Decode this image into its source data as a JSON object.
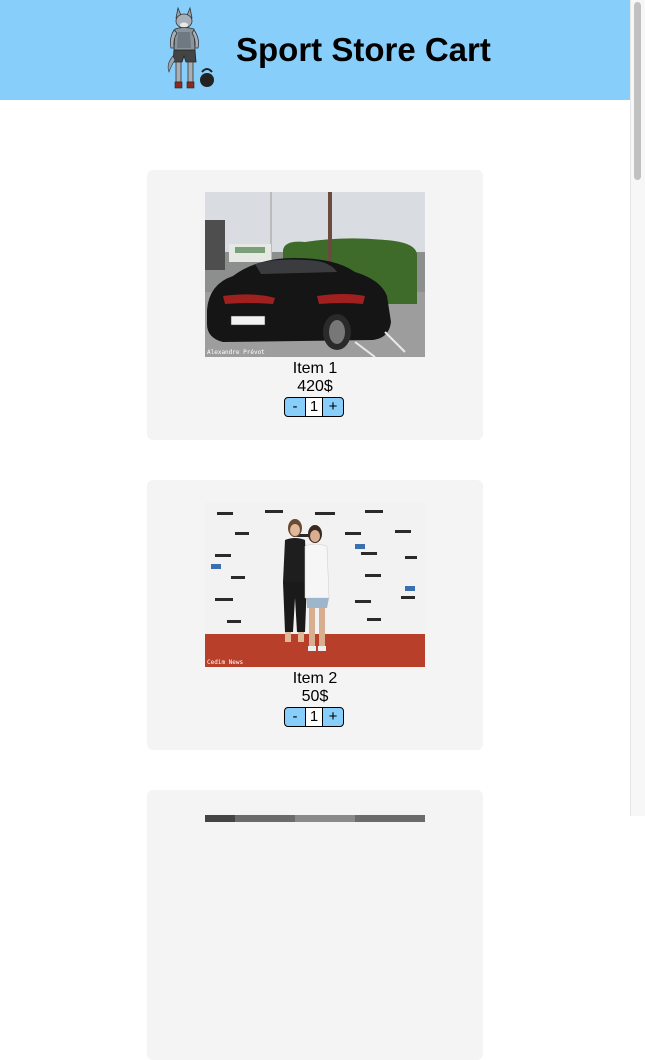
{
  "header": {
    "title": "Sport Store Cart",
    "background": "#87cefa",
    "logo_icon": "wolf-athlete-kettlebell-icon"
  },
  "cart": {
    "items": [
      {
        "name": "Item 1",
        "price": "420$",
        "quantity": "1",
        "decrement_label": "-",
        "increment_label": "+",
        "photo": "black-sports-car-photo",
        "photo_caption": "Alexandre Prévot"
      },
      {
        "name": "Item 2",
        "price": "50$",
        "quantity": "1",
        "decrement_label": "-",
        "increment_label": "+",
        "photo": "two-women-at-event-backdrop-photo",
        "photo_caption": "Cedim News"
      },
      {
        "photo": "item-3-photo-partially-visible"
      }
    ]
  },
  "colors": {
    "accent": "#87cefa",
    "card_background": "#f4f4f4"
  }
}
